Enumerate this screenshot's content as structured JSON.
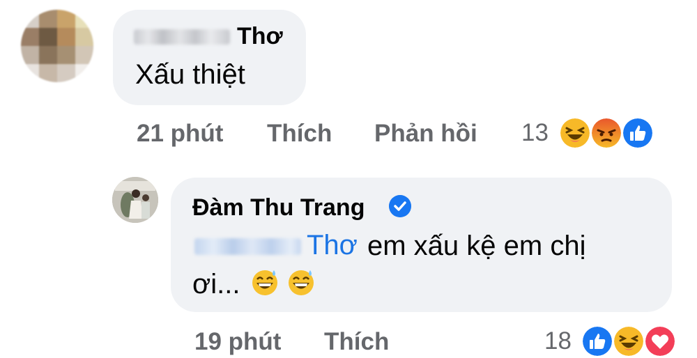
{
  "comment1": {
    "author_suffix": "Thơ",
    "text": "Xấu thiệt",
    "time": "21 phút",
    "like": "Thích",
    "reply": "Phản hồi",
    "reaction_count": "13",
    "reactions": [
      "haha-emoji-icon",
      "angry-emoji-icon",
      "like-reaction-icon"
    ]
  },
  "reply1": {
    "author": "Đàm Thu Trang",
    "verified_icon": "verified-badge-icon",
    "mention": "Thơ",
    "text_line1": "em xấu kệ em chị",
    "text_line2": "ơi...",
    "inline_emojis": [
      "grinning-sweat-emoji",
      "grinning-sweat-emoji"
    ],
    "time": "19 phút",
    "like": "Thích",
    "reaction_count": "18",
    "reactions": [
      "like-reaction-icon",
      "haha-emoji-icon",
      "love-reaction-icon"
    ]
  },
  "colors": {
    "bubble": "#f0f2f5",
    "meta_text": "#65676b",
    "mention": "#1b74e4",
    "verified": "#1877f2"
  }
}
